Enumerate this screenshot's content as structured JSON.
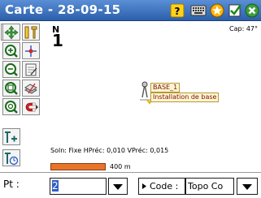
{
  "window": {
    "title": "Carte - 28-09-15"
  },
  "titlebar_icons": [
    "help-icon",
    "keyboard-icon",
    "star-icon",
    "check-list-icon",
    "close-icon"
  ],
  "colors": {
    "titlebar": "#2c5faa",
    "scale_bar": "#e8742a",
    "label_text": "#7a1010",
    "selection": "#2f5fc4"
  },
  "toolbar": {
    "tools": [
      "pan-icon",
      "measure-icon",
      "zoom-in-icon",
      "center-point-icon",
      "zoom-out-icon",
      "edit-note-icon",
      "zoom-window-icon",
      "layers-icon",
      "zoom-extent-icon",
      "magnet-icon",
      "add-point-icon",
      "time-icon"
    ]
  },
  "map": {
    "north_letter": "N",
    "north_value": "1",
    "cap": "Cap: 47°",
    "point": {
      "name": "BASE_1",
      "description": "Installation de base"
    },
    "status": "Soln: Fixe  HPréc: 0,010  VPréc: 0,015",
    "scale_label": "400 m"
  },
  "bottom": {
    "pt_label": "Pt :",
    "pt_value": "2",
    "code_button": "Code :",
    "code_value": "Topo Co"
  }
}
